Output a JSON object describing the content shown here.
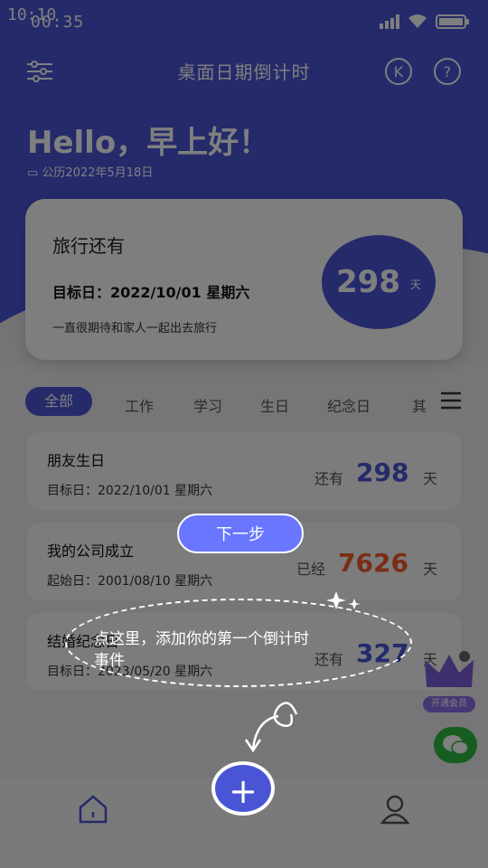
{
  "status_bar": {
    "time": "00:35",
    "time_overlay": "10:10"
  },
  "header": {
    "title": "桌面日期倒计时",
    "settings_icon": "sliders-icon",
    "vip_icon": "k-badge-icon",
    "help_icon": "question-icon"
  },
  "greeting": {
    "text": "Hello，早上好！",
    "date": "公历2022年5月18日"
  },
  "featured": {
    "title": "旅行还有",
    "target_label": "目标日：",
    "target_date": "2022/10/01 星期六",
    "note": "一直很期待和家人一起出去旅行",
    "days": "298",
    "unit": "天"
  },
  "tabs": {
    "items": [
      "全部",
      "工作",
      "学习",
      "生日",
      "纪念日",
      "其"
    ],
    "menu_icon": "hamburger-icon"
  },
  "events": [
    {
      "title": "朋友生日",
      "date_label": "目标日：",
      "date": "2022/10/01 星期六",
      "lead": "还有",
      "days": "298",
      "unit": "天"
    },
    {
      "title": "我的公司成立",
      "date_label": "起始日：",
      "date": "2001/08/10 星期六",
      "lead": "已经",
      "days": "7626",
      "unit": "天"
    },
    {
      "title": "结婚纪念日",
      "date_label": "目标日：",
      "date": "2023/05/20 星期六",
      "lead": "还有",
      "days": "327",
      "unit": "天"
    }
  ],
  "guide": {
    "next": "下一步",
    "tip_line1": "点这里，添加你的第一个倒计时",
    "tip_line2": "事件",
    "add_icon": "plus-icon"
  },
  "vip_badge": {
    "label": "开通会员"
  },
  "colors": {
    "accent": "#4a55d6",
    "orange": "#f25c2c",
    "wechat_green": "#2dbb3f"
  }
}
